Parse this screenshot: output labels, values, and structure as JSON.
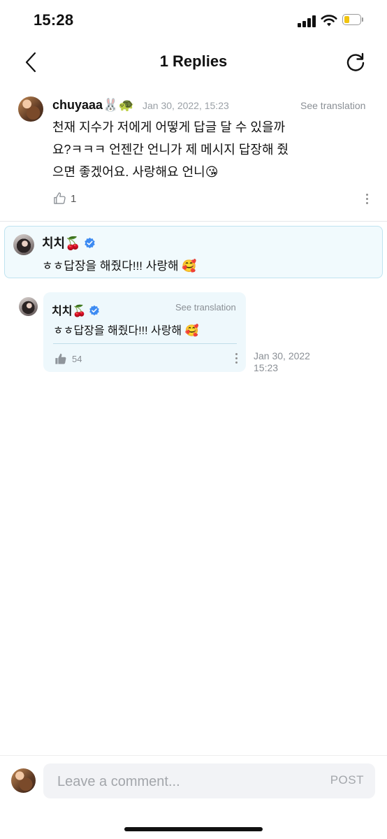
{
  "status_bar": {
    "time": "15:28"
  },
  "nav": {
    "title": "1 Replies"
  },
  "parent_comment": {
    "username": "chuyaaa🐰🐢",
    "timestamp": "Jan 30, 2022, 15:23",
    "see_translation": "See translation",
    "text_lines": [
      "천재 지수가 저에게 어떻게 답글 달 수 있을까",
      "요?ㅋㅋㅋ 언젠간 언니가 제 메시지 답장해 줬",
      "으면 좋겠어요. 사랑해요 언니😘"
    ],
    "like_count": "1"
  },
  "highlighted_reply": {
    "username": "치치🍒",
    "text": "ㅎㅎ답장을 해줬다!!!  사랑해 🥰"
  },
  "reply": {
    "username": "치치🍒",
    "see_translation": "See translation",
    "text": "ㅎㅎ답장을 해줬다!!!  사랑해 🥰",
    "like_count": "54",
    "date_line1": "Jan 30, 2022",
    "date_line2": "15:23"
  },
  "comment_bar": {
    "placeholder": "Leave a comment...",
    "post_label": "POST"
  },
  "colors": {
    "verified_blue": "#3d8bf2",
    "highlight_border": "#bfe3f0",
    "battery_yellow": "#f1c40f"
  }
}
